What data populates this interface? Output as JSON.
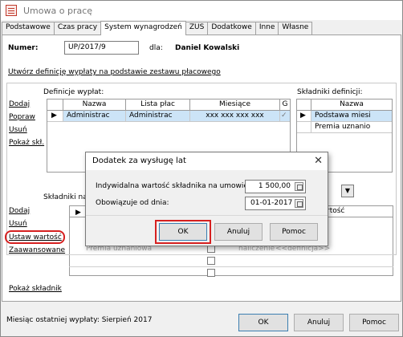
{
  "window": {
    "title": "Umowa o pracę"
  },
  "tabs": [
    "Podstawowe",
    "Czas pracy",
    "System wynagrodzeń",
    "ZUS",
    "Dodatkowe",
    "Inne",
    "Własne"
  ],
  "form": {
    "numer_label": "Numer:",
    "numer_value": "UP/2017/9",
    "dla_label": "dla:",
    "employee": "Daniel Kowalski",
    "create_link": "Utwórz definicję wypłaty na podstawie zestawu płacowego"
  },
  "definicje": {
    "title": "Definicje wypłat:",
    "actions": [
      "Dodaj",
      "Popraw",
      "Usuń",
      "Pokaż skł."
    ],
    "columns": [
      "Nazwa",
      "Lista płac",
      "Miesiące",
      "G"
    ],
    "rows": [
      [
        "Administrac",
        "Administrac",
        "xxx xxx xxx xxx"
      ]
    ]
  },
  "skladniki_def": {
    "title": "Składniki definicji:",
    "column": "Nazwa",
    "rows": [
      "Podstawa miesi",
      "Premia uznanio"
    ]
  },
  "skladniki_umowy": {
    "title": "Składniki na u",
    "actions": [
      "Dodaj",
      "Usuń",
      "Ustaw wartość",
      "Zaawansowane"
    ],
    "col_right": "rtość",
    "row_left": "Premia uznaniowa",
    "row_mid": "naliczenie",
    "row_right": "<<definicja>>",
    "show_link": "Pokaż składnik"
  },
  "dialog": {
    "title": "Dodatek za wysługę lat",
    "close": "✕",
    "field1_label": "Indywidalna wartość składnika na umowie:",
    "field1_value": "1 500,00",
    "field2_label": "Obowiązuje od dnia:",
    "field2_value": "01-01-2017",
    "ok": "OK",
    "cancel": "Anuluj",
    "help": "Pomoc"
  },
  "footer": {
    "status": "Miesiąc ostatniej wypłaty: Sierpień 2017",
    "ok": "OK",
    "cancel": "Anuluj",
    "help": "Pomoc"
  },
  "colors": {
    "highlight": "#d62020",
    "selection": "#cce4f7"
  }
}
